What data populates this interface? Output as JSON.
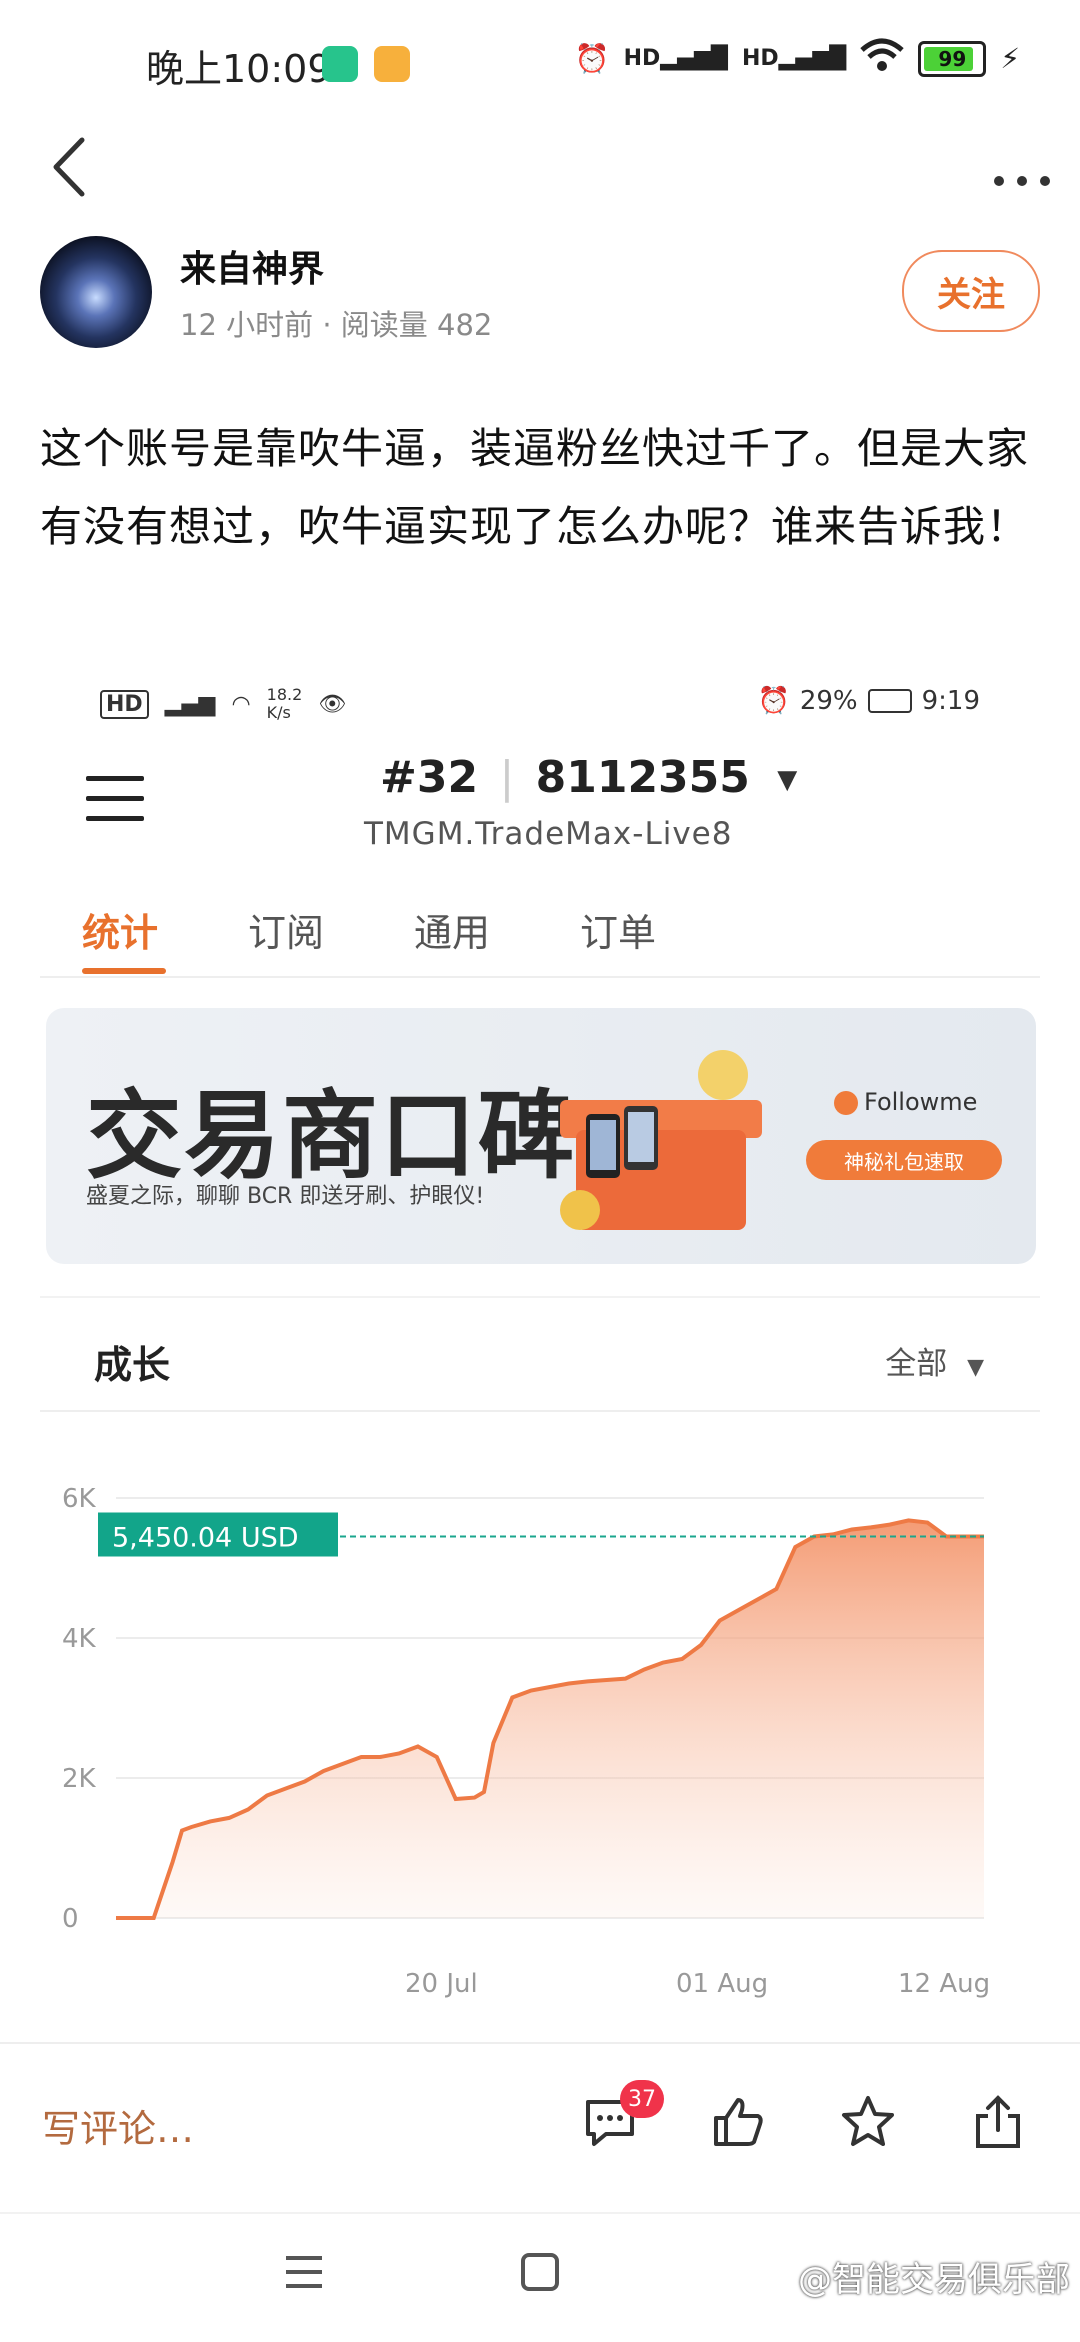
{
  "status_bar": {
    "time": "晚上10:09",
    "battery": "99"
  },
  "author": {
    "name": "来自神界",
    "meta": "12 小时前 · 阅读量 482",
    "follow_label": "关注"
  },
  "post": {
    "text": "这个账号是靠吹牛逼，装逼粉丝快过千了。但是大家有没有想过，吹牛逼实现了怎么办呢？谁来告诉我！"
  },
  "screenshot": {
    "status_left": {
      "speed_top": "18.2",
      "speed_bottom": "K/s"
    },
    "status_right": {
      "battery": "29%",
      "time": "9:19"
    },
    "account": {
      "rank": "#32",
      "number": "8112355",
      "server": "TMGM.TradeMax-Live8"
    },
    "tabs": [
      {
        "label": "统计"
      },
      {
        "label": "订阅"
      },
      {
        "label": "通用"
      },
      {
        "label": "订单"
      }
    ],
    "banner": {
      "title": "交易商口碑",
      "subtitle": "盛夏之际，聊聊 BCR 即送牙刷、护眼仪!",
      "brand": "Followme",
      "button": "神秘礼包速取"
    },
    "growth": {
      "title": "成长",
      "range": "全部"
    }
  },
  "chart_data": {
    "type": "area",
    "current_label": "5,450.04 USD",
    "current_value": 5450.04,
    "y_ticks": [
      "0",
      "2K",
      "4K",
      "6K"
    ],
    "ylim": [
      0,
      6000
    ],
    "x_tick_labels": [
      "20 Jul",
      "01 Aug",
      "12 Aug"
    ],
    "x": [
      0,
      2,
      3,
      3.5,
      4,
      5,
      6,
      7,
      8,
      9,
      10,
      11,
      12,
      13,
      14,
      15,
      16,
      17,
      18,
      19,
      19.5,
      20,
      21,
      22,
      23,
      24,
      25,
      26,
      27,
      28,
      29,
      30,
      31,
      32,
      33,
      34,
      35,
      36,
      37,
      38,
      39,
      40,
      41,
      42,
      43,
      44,
      45,
      46
    ],
    "values": [
      0,
      0,
      800,
      1250,
      1300,
      1380,
      1430,
      1550,
      1750,
      1850,
      1950,
      2100,
      2200,
      2300,
      2300,
      2350,
      2450,
      2300,
      1700,
      1720,
      1800,
      2500,
      3150,
      3250,
      3300,
      3350,
      3380,
      3400,
      3420,
      3550,
      3650,
      3700,
      3900,
      4250,
      4400,
      4550,
      4700,
      5300,
      5450,
      5480,
      5550,
      5580,
      5620,
      5680,
      5650,
      5450,
      5450,
      5450
    ],
    "series_color": "#ee7a45",
    "grid": true
  },
  "bottom_bar": {
    "comment_placeholder": "写评论…",
    "comment_count": "37"
  },
  "watermark": "@智能交易俱乐部"
}
